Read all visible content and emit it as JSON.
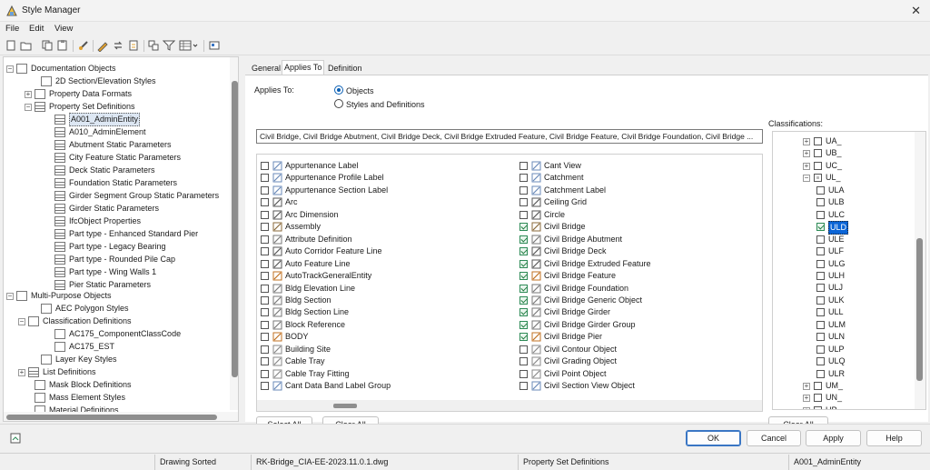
{
  "window": {
    "title": "Style Manager",
    "close_glyph": "✕"
  },
  "menu": [
    "File",
    "Edit",
    "View"
  ],
  "toolbar_icons": [
    "new-icon",
    "open-icon",
    "copy-icon",
    "paste-icon",
    "purge-icon",
    "edit-icon",
    "repath-icon",
    "toggle-icon",
    "sort-icon",
    "filter-icon",
    "view-icon",
    "settings-icon"
  ],
  "tree": {
    "items": [
      {
        "label": "Documentation Objects",
        "icon": "folder",
        "expand": "−"
      },
      {
        "label": "2D Section/Elevation Styles",
        "icon": "doc",
        "expand": ""
      },
      {
        "label": "Property Data Formats",
        "icon": "doc",
        "expand": "+"
      },
      {
        "label": "Property Set Definitions",
        "icon": "grid",
        "expand": "−"
      },
      {
        "label": "A001_AdminEntity",
        "icon": "grid",
        "expand": "",
        "selected": true
      },
      {
        "label": "A010_AdminElement",
        "icon": "grid",
        "expand": ""
      },
      {
        "label": "Abutment Static Parameters",
        "icon": "grid",
        "expand": ""
      },
      {
        "label": "City Feature Static Parameters",
        "icon": "grid",
        "expand": ""
      },
      {
        "label": "Deck Static Parameters",
        "icon": "grid",
        "expand": ""
      },
      {
        "label": "Foundation Static Parameters",
        "icon": "grid",
        "expand": ""
      },
      {
        "label": "Girder Segment Group Static Parameters",
        "icon": "grid",
        "expand": ""
      },
      {
        "label": "Girder Static Parameters",
        "icon": "grid",
        "expand": ""
      },
      {
        "label": "IfcObject Properties",
        "icon": "grid",
        "expand": ""
      },
      {
        "label": "Part type - Enhanced Standard Pier",
        "icon": "grid",
        "expand": ""
      },
      {
        "label": "Part type - Legacy Bearing",
        "icon": "grid",
        "expand": ""
      },
      {
        "label": "Part type - Rounded Pile Cap",
        "icon": "grid",
        "expand": ""
      },
      {
        "label": "Part type - Wing Walls 1",
        "icon": "grid",
        "expand": ""
      },
      {
        "label": "Pier Static Parameters",
        "icon": "grid",
        "expand": ""
      },
      {
        "label": "Multi-Purpose Objects",
        "icon": "folder",
        "expand": "−"
      },
      {
        "label": "AEC Polygon Styles",
        "icon": "doc",
        "expand": ""
      },
      {
        "label": "Classification Definitions",
        "icon": "tree",
        "expand": "−"
      },
      {
        "label": "AC175_ComponentClassCode",
        "icon": "tree",
        "expand": ""
      },
      {
        "label": "AC175_EST",
        "icon": "tree",
        "expand": ""
      },
      {
        "label": "Layer Key Styles",
        "icon": "doc",
        "expand": ""
      },
      {
        "label": "List Definitions",
        "icon": "grid",
        "expand": "+"
      },
      {
        "label": "Mask Block Definitions",
        "icon": "doc",
        "expand": ""
      },
      {
        "label": "Mass Element Styles",
        "icon": "doc",
        "expand": ""
      },
      {
        "label": "Material Definitions",
        "icon": "doc",
        "expand": ""
      }
    ]
  },
  "tabs": [
    "General",
    "Applies To",
    "Definition"
  ],
  "applies": {
    "label": "Applies To:",
    "radio_objects": "Objects",
    "radio_styles": "Styles and Definitions",
    "summary": "Civil Bridge, Civil Bridge Abutment, Civil Bridge Deck, Civil Bridge Extruded Feature, Civil Bridge Feature, Civil Bridge Foundation, Civil Bridge ..."
  },
  "objects_left": [
    {
      "label": "Appurtenance Label",
      "checked": false
    },
    {
      "label": "Appurtenance Profile Label",
      "checked": false
    },
    {
      "label": "Appurtenance Section Label",
      "checked": false
    },
    {
      "label": "Arc",
      "checked": false
    },
    {
      "label": "Arc Dimension",
      "checked": false
    },
    {
      "label": "Assembly",
      "checked": false
    },
    {
      "label": "Attribute Definition",
      "checked": false
    },
    {
      "label": "Auto Corridor Feature Line",
      "checked": false
    },
    {
      "label": "Auto Feature Line",
      "checked": false
    },
    {
      "label": "AutoTrackGeneralEntity",
      "checked": false
    },
    {
      "label": "Bldg Elevation Line",
      "checked": false
    },
    {
      "label": "Bldg Section",
      "checked": false
    },
    {
      "label": "Bldg Section Line",
      "checked": false
    },
    {
      "label": "Block Reference",
      "checked": false
    },
    {
      "label": "BODY",
      "checked": false
    },
    {
      "label": "Building Site",
      "checked": false
    },
    {
      "label": "Cable Tray",
      "checked": false
    },
    {
      "label": "Cable Tray Fitting",
      "checked": false
    },
    {
      "label": "Cant Data Band Label Group",
      "checked": false
    }
  ],
  "objects_right": [
    {
      "label": "Cant View",
      "checked": false
    },
    {
      "label": "Catchment",
      "checked": false
    },
    {
      "label": "Catchment Label",
      "checked": false
    },
    {
      "label": "Ceiling Grid",
      "checked": false
    },
    {
      "label": "Circle",
      "checked": false
    },
    {
      "label": "Civil Bridge",
      "checked": true
    },
    {
      "label": "Civil Bridge Abutment",
      "checked": true
    },
    {
      "label": "Civil Bridge Deck",
      "checked": true
    },
    {
      "label": "Civil Bridge Extruded Feature",
      "checked": true
    },
    {
      "label": "Civil Bridge Feature",
      "checked": true
    },
    {
      "label": "Civil Bridge Foundation",
      "checked": true
    },
    {
      "label": "Civil Bridge Generic Object",
      "checked": true
    },
    {
      "label": "Civil Bridge Girder",
      "checked": true
    },
    {
      "label": "Civil Bridge Girder Group",
      "checked": true
    },
    {
      "label": "Civil Bridge Pier",
      "checked": true
    },
    {
      "label": "Civil Contour Object",
      "checked": false
    },
    {
      "label": "Civil Grading Object",
      "checked": false
    },
    {
      "label": "Civil Point Object",
      "checked": false
    },
    {
      "label": "Civil Section View Object",
      "checked": false
    }
  ],
  "buttons": {
    "select_all": "Select All",
    "clear_all": "Clear All",
    "class_clear_all": "Clear All",
    "ok": "OK",
    "cancel": "Cancel",
    "apply": "Apply",
    "help": "Help"
  },
  "classifications": {
    "label": "Classifications:",
    "items": [
      {
        "label": "UA_",
        "level": 0,
        "expand": "+",
        "state": "off"
      },
      {
        "label": "UB_",
        "level": 0,
        "expand": "+",
        "state": "off"
      },
      {
        "label": "UC_",
        "level": 0,
        "expand": "+",
        "state": "off"
      },
      {
        "label": "UL_",
        "level": 0,
        "expand": "−",
        "state": "part"
      },
      {
        "label": "ULA",
        "level": 1,
        "expand": "",
        "state": "off"
      },
      {
        "label": "ULB",
        "level": 1,
        "expand": "",
        "state": "off"
      },
      {
        "label": "ULC",
        "level": 1,
        "expand": "",
        "state": "off"
      },
      {
        "label": "ULD",
        "level": 1,
        "expand": "",
        "state": "on",
        "selected": true
      },
      {
        "label": "ULE",
        "level": 1,
        "expand": "",
        "state": "off"
      },
      {
        "label": "ULF",
        "level": 1,
        "expand": "",
        "state": "off"
      },
      {
        "label": "ULG",
        "level": 1,
        "expand": "",
        "state": "off"
      },
      {
        "label": "ULH",
        "level": 1,
        "expand": "",
        "state": "off"
      },
      {
        "label": "ULJ",
        "level": 1,
        "expand": "",
        "state": "off"
      },
      {
        "label": "ULK",
        "level": 1,
        "expand": "",
        "state": "off"
      },
      {
        "label": "ULL",
        "level": 1,
        "expand": "",
        "state": "off"
      },
      {
        "label": "ULM",
        "level": 1,
        "expand": "",
        "state": "off"
      },
      {
        "label": "ULN",
        "level": 1,
        "expand": "",
        "state": "off"
      },
      {
        "label": "ULP",
        "level": 1,
        "expand": "",
        "state": "off"
      },
      {
        "label": "ULQ",
        "level": 1,
        "expand": "",
        "state": "off"
      },
      {
        "label": "ULR",
        "level": 1,
        "expand": "",
        "state": "off"
      },
      {
        "label": "UM_",
        "level": 0,
        "expand": "+",
        "state": "off"
      },
      {
        "label": "UN_",
        "level": 0,
        "expand": "+",
        "state": "off"
      },
      {
        "label": "UP_",
        "level": 0,
        "expand": "+",
        "state": "off"
      }
    ]
  },
  "status": {
    "sort": "Drawing Sorted",
    "file": "RK-Bridge_CIA-EE-2023.11.0.1.dwg",
    "category": "Property Set Definitions",
    "selection": "A001_AdminEntity"
  },
  "colors": {
    "accent": "#0a64d6",
    "check_green": "#1d7a3d",
    "selection_bg": "#dde7f3"
  }
}
